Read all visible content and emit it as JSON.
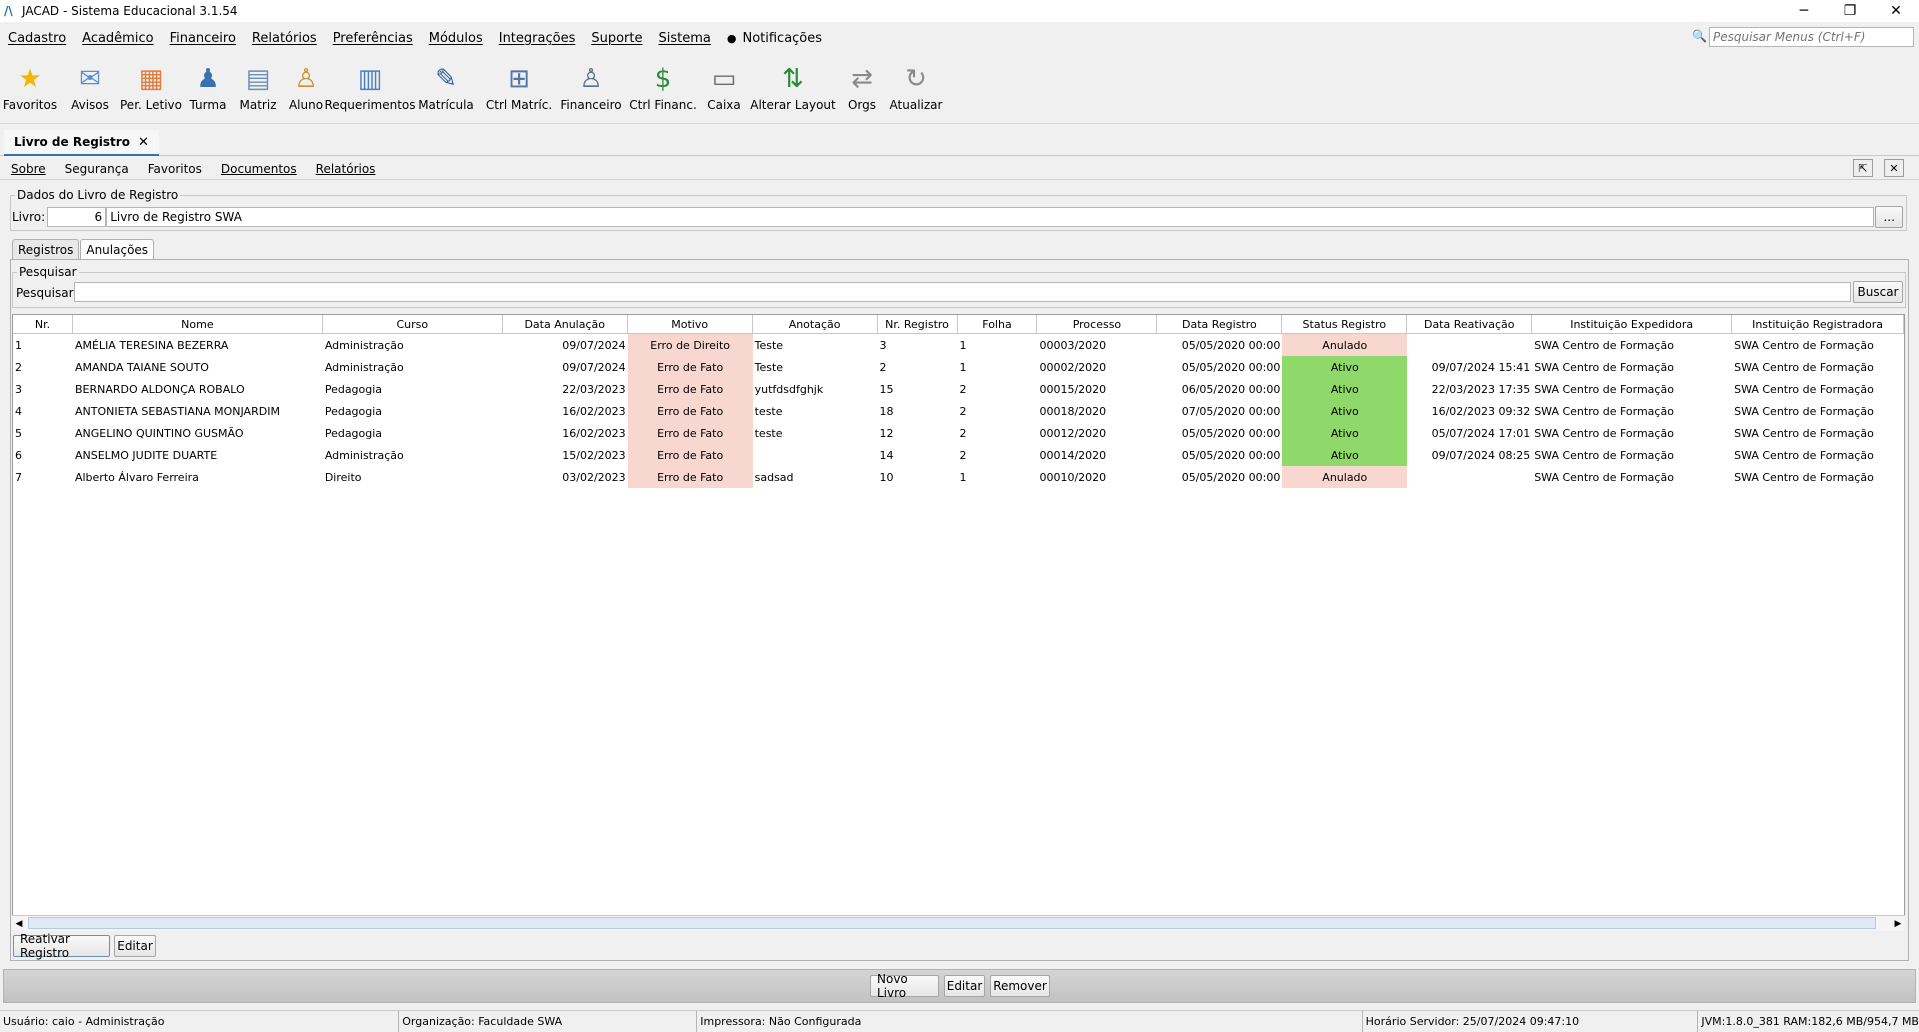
{
  "window": {
    "title": "JACAD - Sistema Educacional 3.1.54",
    "logo": "JACAD logo",
    "controls": {
      "minimize": "─",
      "restore": "❐",
      "close": "✕"
    }
  },
  "menu": {
    "items": [
      "Cadastro",
      "Acadêmico",
      "Financeiro",
      "Relatórios",
      "Preferências",
      "Módulos",
      "Integrações",
      "Suporte",
      "Sistema"
    ],
    "notifications": "Notificações",
    "search_placeholder": "Pesquisar Menus (Ctrl+F)"
  },
  "toolbar": [
    {
      "label": "Favoritos",
      "icon": "star-icon",
      "glyph": "★",
      "color": "#f2b705"
    },
    {
      "label": "Avisos",
      "icon": "envelope-icon",
      "glyph": "✉",
      "color": "#5b8fcf"
    },
    {
      "label": "Per. Letivo",
      "icon": "calendar-icon",
      "glyph": "▦",
      "color": "#e07b39"
    },
    {
      "label": "Turma",
      "icon": "class-icon",
      "glyph": "♟",
      "color": "#3a6fb0"
    },
    {
      "label": "Matriz",
      "icon": "matrix-icon",
      "glyph": "▤",
      "color": "#6b8fb5"
    },
    {
      "label": "Aluno",
      "icon": "student-icon",
      "glyph": "♙",
      "color": "#c8932e"
    },
    {
      "label": "Requerimentos",
      "icon": "request-icon",
      "glyph": "▥",
      "color": "#4a7fc0"
    },
    {
      "label": "Matrícula",
      "icon": "enrollment-icon",
      "glyph": "✎",
      "color": "#2d5f9e"
    },
    {
      "label": "Ctrl Matríc.",
      "icon": "enrollment-control-icon",
      "glyph": "⊞",
      "color": "#5276a3"
    },
    {
      "label": "Financeiro",
      "icon": "finance-icon",
      "glyph": "♙",
      "color": "#5a6f8a"
    },
    {
      "label": "Ctrl Financ.",
      "icon": "money-hand-icon",
      "glyph": "$",
      "color": "#2e8b3d"
    },
    {
      "label": "Caixa",
      "icon": "cash-register-icon",
      "glyph": "▭",
      "color": "#6c6c6c"
    },
    {
      "label": "Alterar Layout",
      "icon": "swap-layout-icon",
      "glyph": "⇅",
      "color": "#2a8a3a"
    },
    {
      "label": "Orgs",
      "icon": "arrows-icon",
      "glyph": "⇄",
      "color": "#8a8a8a"
    },
    {
      "label": "Atualizar",
      "icon": "refresh-icon",
      "glyph": "↻",
      "color": "#8a8a8a"
    }
  ],
  "doc_tab": {
    "label": "Livro de Registro",
    "close": "✕"
  },
  "submenu": {
    "items": [
      "Sobre",
      "Segurança",
      "Favoritos",
      "Documentos",
      "Relatórios"
    ],
    "detach": "⇱",
    "close": "✕"
  },
  "livro": {
    "legend": "Dados do Livro de Registro",
    "label": "Livro:",
    "code": "6",
    "name": "Livro de Registro SWA",
    "lookup": "..."
  },
  "tabs": [
    {
      "label": "Registros",
      "active": false
    },
    {
      "label": "Anulações",
      "active": true
    }
  ],
  "search": {
    "legend": "Pesquisar",
    "label": "Pesquisar:",
    "value": "",
    "button": "Buscar"
  },
  "grid": {
    "columns": [
      "Nr.",
      "Nome",
      "Curso",
      "Data Anulação",
      "Motivo",
      "Anotação",
      "Nr. Registro",
      "Folha",
      "Processo",
      "Data Registro",
      "Status Registro",
      "Data Reativação",
      "Instituição Expedidora",
      "Instituição Registradora"
    ],
    "rows": [
      [
        "1",
        "AMÉLIA TERESINA BEZERRA",
        "Administração",
        "09/07/2024",
        "Erro de Direito",
        "Teste",
        "3",
        "1",
        "00003/2020",
        "05/05/2020 00:00",
        "Anulado",
        "",
        "SWA Centro de Formação",
        "SWA Centro de Formação"
      ],
      [
        "2",
        "AMANDA TAIANE SOUTO",
        "Administração",
        "09/07/2024",
        "Erro de Fato",
        "Teste",
        "2",
        "1",
        "00002/2020",
        "05/05/2020 00:00",
        "Ativo",
        "09/07/2024 15:41",
        "SWA Centro de Formação",
        "SWA Centro de Formação"
      ],
      [
        "3",
        "BERNARDO ALDONÇA ROBALO",
        "Pedagogia",
        "22/03/2023",
        "Erro de Fato",
        "yutfdsdfghjk",
        "15",
        "2",
        "00015/2020",
        "06/05/2020 00:00",
        "Ativo",
        "22/03/2023 17:35",
        "SWA Centro de Formação",
        "SWA Centro de Formação"
      ],
      [
        "4",
        "ANTONIETA SEBASTIANA MONJARDIM",
        "Pedagogia",
        "16/02/2023",
        "Erro de Fato",
        "teste",
        "18",
        "2",
        "00018/2020",
        "07/05/2020 00:00",
        "Ativo",
        "16/02/2023 09:32",
        "SWA Centro de Formação",
        "SWA Centro de Formação"
      ],
      [
        "5",
        "ANGELINO QUINTINO GUSMÃO",
        "Pedagogia",
        "16/02/2023",
        "Erro de Fato",
        "teste",
        "12",
        "2",
        "00012/2020",
        "05/05/2020 00:00",
        "Ativo",
        "05/07/2024 17:01",
        "SWA Centro de Formação",
        "SWA Centro de Formação"
      ],
      [
        "6",
        "ANSELMO JUDITE DUARTE",
        "Administração",
        "15/02/2023",
        "Erro de Fato",
        "",
        "14",
        "2",
        "00014/2020",
        "05/05/2020 00:00",
        "Ativo",
        "09/07/2024 08:25",
        "SWA Centro de Formação",
        "SWA Centro de Formação"
      ],
      [
        "7",
        "Alberto Álvaro Ferreira",
        "Direito",
        "03/02/2023",
        "Erro de Fato",
        "sadsad",
        "10",
        "1",
        "00010/2020",
        "05/05/2020 00:00",
        "Anulado",
        "",
        "SWA Centro de Formação",
        "SWA Centro de Formação"
      ]
    ],
    "status_colors": {
      "Anulado": "#f8d7d0",
      "Ativo": "#8fd96a"
    },
    "motivo_color": "#f8d7d0"
  },
  "grid_actions": {
    "reactivate": "Reativar Registro",
    "edit": "Editar"
  },
  "footer_actions": {
    "new": "Novo Livro",
    "edit": "Editar",
    "remove": "Remover"
  },
  "status": {
    "user": "Usuário: caio - Administração",
    "org": "Organização: Faculdade SWA",
    "printer": "Impressora: Não Configurada",
    "server_time": "Horário Servidor: 25/07/2024 09:47:10",
    "jvm": "JVM:1.8.0_381  RAM:182,6 MB/954,7 MB"
  }
}
